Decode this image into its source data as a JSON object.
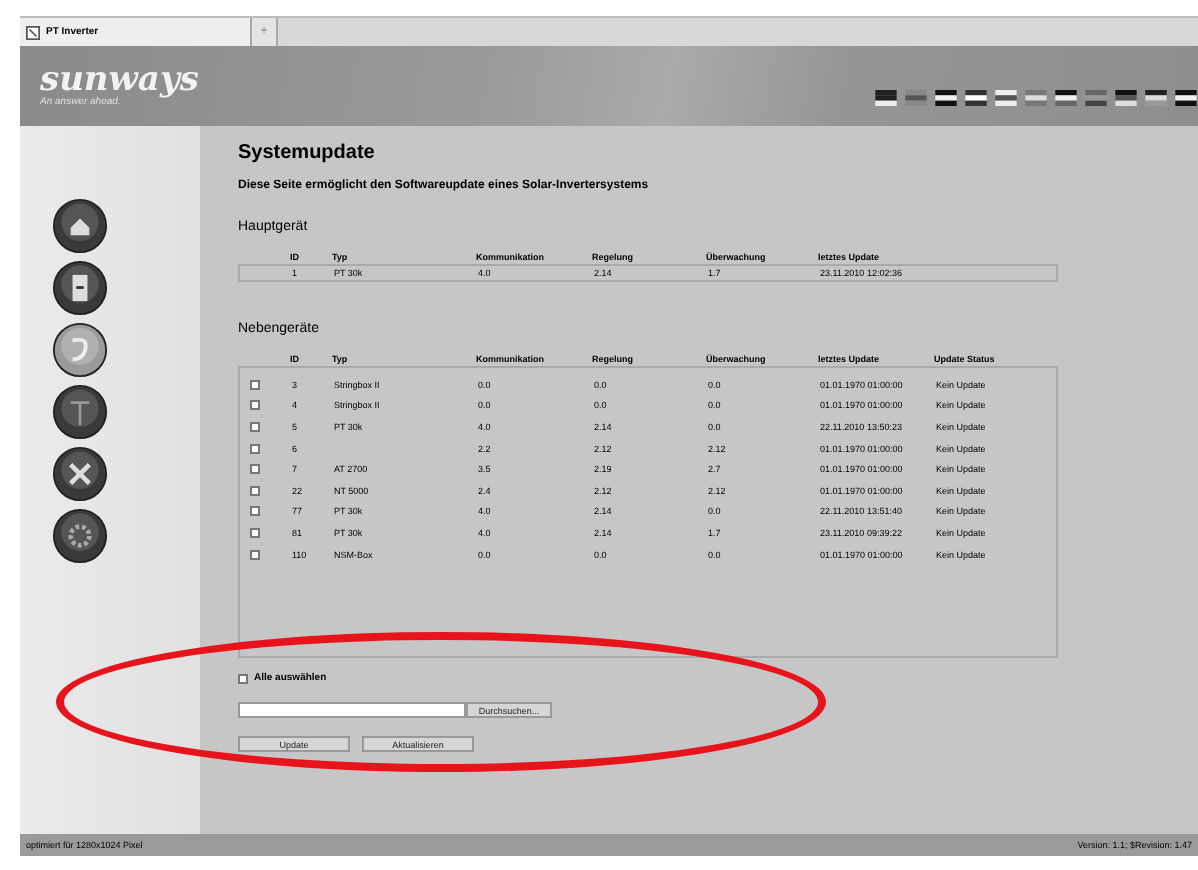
{
  "browser_tab": {
    "title": "PT Inverter",
    "new_tab": "+"
  },
  "header": {
    "logo": "sunways",
    "tagline": "An answer ahead."
  },
  "nav": [
    {
      "kind": "house",
      "selected": false
    },
    {
      "kind": "device",
      "selected": false
    },
    {
      "kind": "cable",
      "selected": true
    },
    {
      "kind": "pole",
      "selected": false
    },
    {
      "kind": "tools",
      "selected": false
    },
    {
      "kind": "gear",
      "selected": false
    }
  ],
  "title": "Systemupdate",
  "description": "Diese Seite ermöglicht den Softwareupdate eines Solar-Invertersystems",
  "main_device": {
    "heading": "Hauptgerät",
    "columns": [
      "ID",
      "Typ",
      "Kommunikation",
      "Regelung",
      "Überwachung",
      "letztes Update"
    ],
    "rows": [
      [
        "1",
        "PT 30k",
        "4.0",
        "2.14",
        "1.7",
        "23.11.2010 12:02:36"
      ]
    ]
  },
  "secondary_devices": {
    "heading": "Nebengeräte",
    "columns": [
      "ID",
      "Typ",
      "Kommunikation",
      "Regelung",
      "Überwachung",
      "letztes Update",
      "Update Status"
    ],
    "rows": [
      {
        "checked": false,
        "cells": [
          "3",
          "Stringbox II",
          "0.0",
          "0.0",
          "0.0",
          "01.01.1970 01:00:00",
          "Kein Update"
        ]
      },
      {
        "checked": false,
        "cells": [
          "4",
          "Stringbox II",
          "0.0",
          "0.0",
          "0.0",
          "01.01.1970 01:00:00",
          "Kein Update"
        ]
      },
      {
        "checked": false,
        "cells": [
          "5",
          "PT 30k",
          "4.0",
          "2.14",
          "0.0",
          "22.11.2010 13:50:23",
          "Kein Update"
        ]
      },
      {
        "checked": false,
        "cells": [
          "6",
          "",
          "2.2",
          "2.12",
          "2.12",
          "01.01.1970 01:00:00",
          "Kein Update"
        ]
      },
      {
        "checked": false,
        "cells": [
          "7",
          "AT 2700",
          "3.5",
          "2.19",
          "2.7",
          "01.01.1970 01:00:00",
          "Kein Update"
        ]
      },
      {
        "checked": false,
        "cells": [
          "22",
          "NT 5000",
          "2.4",
          "2.12",
          "2.12",
          "01.01.1970 01:00:00",
          "Kein Update"
        ]
      },
      {
        "checked": false,
        "cells": [
          "77",
          "PT 30k",
          "4.0",
          "2.14",
          "0.0",
          "22.11.2010 13:51:40",
          "Kein Update"
        ]
      },
      {
        "checked": false,
        "cells": [
          "81",
          "PT 30k",
          "4.0",
          "2.14",
          "1.7",
          "23.11.2010 09:39:22",
          "Kein Update"
        ]
      },
      {
        "checked": false,
        "cells": [
          "110",
          "NSM-Box",
          "0.0",
          "0.0",
          "0.0",
          "01.01.1970 01:00:00",
          "Kein Update"
        ]
      }
    ]
  },
  "select_all": {
    "label": "Alle auswählen",
    "checked": false
  },
  "file_browse": {
    "button": "Durchsuchen..."
  },
  "buttons": [
    "Update",
    "Aktualisieren"
  ],
  "footer": {
    "left": "optimiert für 1280x1024 Pixel",
    "right": "Version: 1.1; $Revision: 1.47"
  }
}
